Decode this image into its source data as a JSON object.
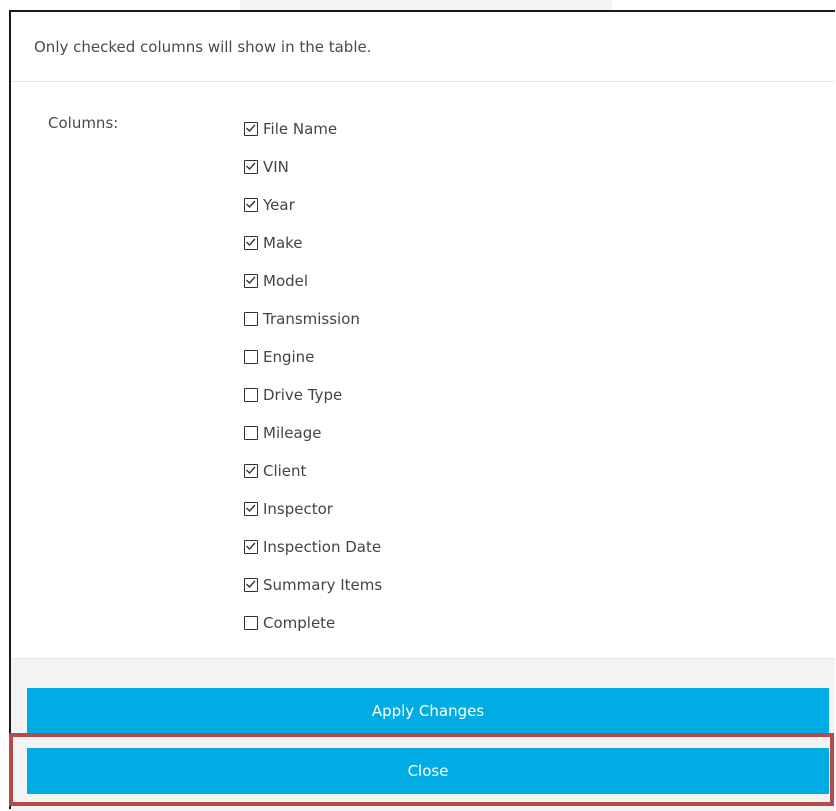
{
  "header": {
    "hint": "Only checked columns will show in the table."
  },
  "form": {
    "columns_label": "Columns:",
    "columns": [
      {
        "label": "File Name",
        "checked": true
      },
      {
        "label": "VIN",
        "checked": true
      },
      {
        "label": "Year",
        "checked": true
      },
      {
        "label": "Make",
        "checked": true
      },
      {
        "label": "Model",
        "checked": true
      },
      {
        "label": "Transmission",
        "checked": false
      },
      {
        "label": "Engine",
        "checked": false
      },
      {
        "label": "Drive Type",
        "checked": false
      },
      {
        "label": "Mileage",
        "checked": false
      },
      {
        "label": "Client",
        "checked": true
      },
      {
        "label": "Inspector",
        "checked": true
      },
      {
        "label": "Inspection Date",
        "checked": true
      },
      {
        "label": "Summary Items",
        "checked": true
      },
      {
        "label": "Complete",
        "checked": false
      }
    ]
  },
  "footer": {
    "apply_label": "Apply Changes",
    "close_label": "Close"
  },
  "colors": {
    "button": "#00ace3",
    "highlight": "#b54a4a"
  }
}
